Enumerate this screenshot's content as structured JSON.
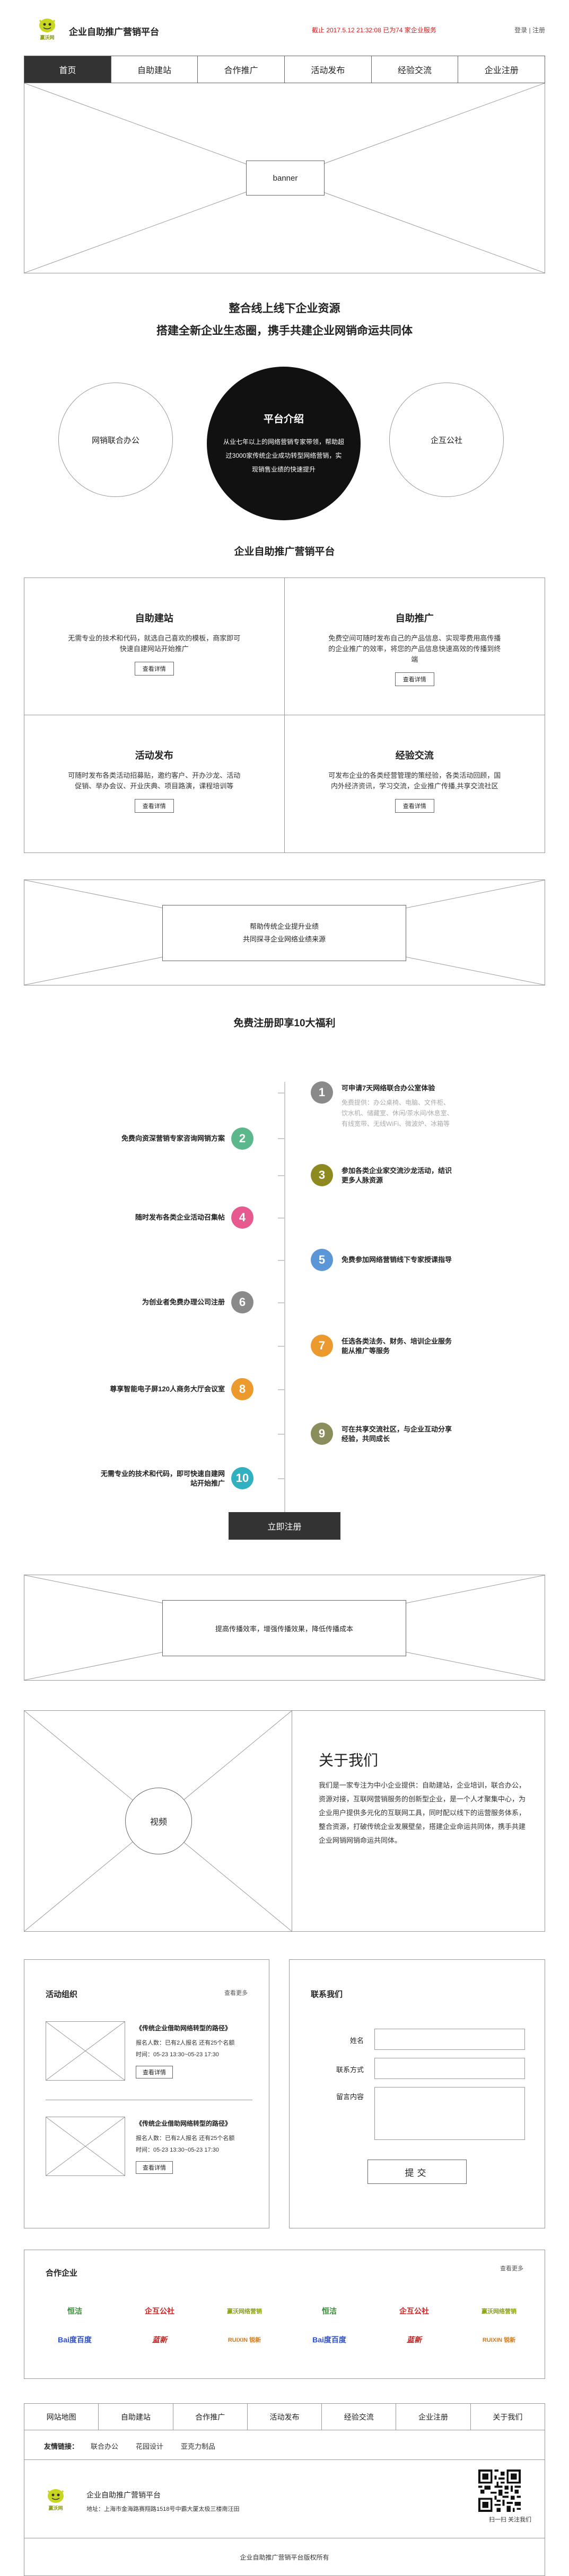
{
  "header": {
    "logo_text": "赢沃网",
    "site_title": "企业自助推广营销平台",
    "notice": "截止 2017.5.12 21:32:08 已为74 家企业服务",
    "login": "登录",
    "sep": "|",
    "register": "注册"
  },
  "nav": [
    "首页",
    "自助建站",
    "合作推广",
    "活动发布",
    "经验交流",
    "企业注册"
  ],
  "banner": {
    "label": "banner"
  },
  "intro": {
    "title1": "整合线上线下企业资源",
    "title2": "搭建全新企业生态圈，携手共建企业网销命运共同体",
    "left": "网销联合办公",
    "center_title": "平台介绍",
    "center_text": "从业七年以上的网络营销专家带领，帮助超过3000家传统企业成功转型网络营销，实现销售业绩的快速提升",
    "right": "企互公社"
  },
  "platform": {
    "title": "企业自助推广营销平台",
    "features": [
      {
        "title": "自助建站",
        "desc": "无需专业的技术和代码，就选自己喜欢的模板，商家即可快速自建网站开始推广",
        "btn": "查看详情"
      },
      {
        "title": "自助推广",
        "desc": "免费空间可随时发布自己的产品信息、实现零费用高传播的企业推广的效率，将您的产品信息快速高效的传播到终端",
        "btn": "查看详情"
      },
      {
        "title": "活动发布",
        "desc": "可随时发布各类活动招募贴，邀约客户、开办沙龙、活动促销、举办会议、开业庆典、项目路演，课程培训等",
        "btn": "查看详情"
      },
      {
        "title": "经验交流",
        "desc": "可发布企业的各类经营管理的策经验，各类活动回顾，国内外经济资讯，学习交流，企业推广传播,共享交流社区",
        "btn": "查看详情"
      }
    ]
  },
  "strip1": {
    "line1": "帮助传统企业提升业绩",
    "line2": "共同探寻企业网络业绩来源"
  },
  "benefits": {
    "title": "免费注册即享10大福利",
    "items": [
      {
        "n": "1",
        "text": "可申请7天网络联合办公室体验",
        "sub": [
          "免费提供：办公桌椅、电脑、文件柜、",
          "饮水机、储藏室、休闲/茶水间/休息室、",
          "有线宽带、无线WiFi、微波炉、冰箱等"
        ]
      },
      {
        "n": "2",
        "text": "免费向资深营销专家咨询网销方案"
      },
      {
        "n": "3",
        "text": "参加各类企业家交流沙龙活动，结识更多人脉资源"
      },
      {
        "n": "4",
        "text": "随时发布各类企业活动召集帖"
      },
      {
        "n": "5",
        "text": "免费参加网络营销线下专家授课指导"
      },
      {
        "n": "6",
        "text": "为创业者免费办理公司注册"
      },
      {
        "n": "7",
        "text": "任选各类法务、财务、培训企业服务能从推广等服务"
      },
      {
        "n": "8",
        "text": "尊享智能电子屏120人商务大厅会议室"
      },
      {
        "n": "9",
        "text": "可在共享交流社区，与企业互动分享经验，共同成长"
      },
      {
        "n": "10",
        "text": "无需专业的技术和代码，即可快速自建网站开始推广"
      }
    ],
    "register_btn": "立即注册"
  },
  "strip2": {
    "text": "提高传播效率，增强传播效果，降低传播成本"
  },
  "about": {
    "video": "视频",
    "title": "关于我们",
    "text": "我们是一家专注为中小企业提供：自助建站，企业培训，联合办公，资源对接，互联网营销服务的创新型企业，是一个人才聚集中心，为企业用户提供多元化的互联网工具，同时配以线下的运营服务体系，整合资源，打破传统企业发展壁垒，搭建企业命运共同体，携手共建企业网销网销命运共同体。"
  },
  "activities": {
    "title": "活动组织",
    "more": "查看更多",
    "items": [
      {
        "title": "《传统企业借助网络转型的路径》",
        "people": "报名人数：已有2人报名 还有25个名额",
        "time": "时间：05-23 13:30~05-23 17:30",
        "btn": "查看详情"
      },
      {
        "title": "《传统企业借助网络转型的路径》",
        "people": "报名人数：已有2人报名 还有25个名额",
        "time": "时间：05-23 13:30~05-23 17:30",
        "btn": "查看详情"
      }
    ]
  },
  "contact": {
    "title": "联系我们",
    "name_label": "姓名",
    "phone_label": "联系方式",
    "msg_label": "留言内容",
    "submit": "提交"
  },
  "partners": {
    "title": "合作企业",
    "more": "查看更多",
    "row1": [
      "恒洁",
      "企互公社",
      "赢沃网络营销",
      "恒洁",
      "企互公社",
      "赢沃网络营销"
    ],
    "row2": [
      "Bai度百度",
      "蓝新",
      "RUIXIN 锐新",
      "Bai度百度",
      "蓝新",
      "RUIXIN 锐新"
    ]
  },
  "footer": {
    "nav": [
      "网站地图",
      "自助建站",
      "合作推广",
      "活动发布",
      "经验交流",
      "企业注册",
      "关于我们"
    ],
    "links_label": "友情链接：",
    "links": [
      "联合办公",
      "花园设计",
      "亚克力制品"
    ],
    "company": "企业自助推广营销平台",
    "address": "地址：上海市金海路赛翔路1518号中霸大厦太极三楼南汪田",
    "qr_caption": "扫一扫 关注我们",
    "copyright": "企业自助推广营销平台版权所有"
  },
  "colors": {
    "accent_red": "#d32020",
    "dark": "#333333",
    "num_gray": "#8a8a8a",
    "num_green": "#5cb88c",
    "num_olive": "#8f8a1f",
    "num_pink": "#e65a8f",
    "num_blue": "#5b96d6",
    "num_orange": "#ec9a2d",
    "num_olivelight": "#8b8e5c",
    "num_cyan": "#31b0c0"
  }
}
